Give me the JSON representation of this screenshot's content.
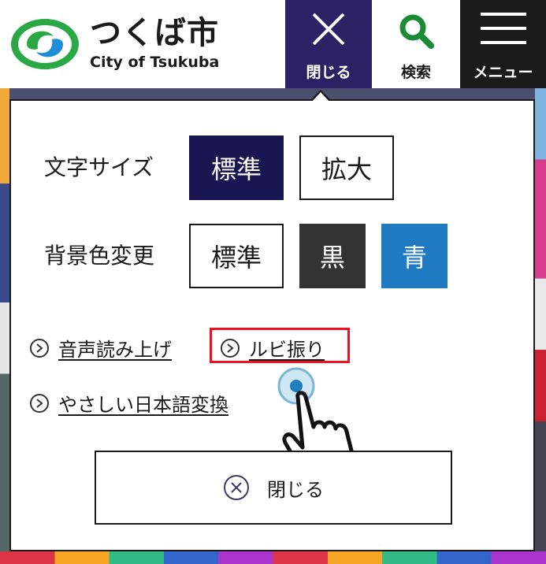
{
  "header": {
    "logo_ja": "つくば市",
    "logo_en": "City of Tsukuba",
    "close_label": "閉じる",
    "search_label": "検索",
    "menu_label": "メニュー"
  },
  "panel": {
    "text_size": {
      "label": "文字サイズ",
      "options": [
        "標準",
        "拡大"
      ],
      "selected": "標準"
    },
    "bg_color": {
      "label": "背景色変更",
      "options": [
        "標準",
        "黒",
        "青"
      ]
    },
    "links": {
      "voice": "音声読み上げ",
      "ruby": "ルビ振り",
      "easy_japanese": "やさしい日本語変換"
    },
    "close_button": "閉じる"
  },
  "colors": {
    "header_close_bg": "#2a2264",
    "active_option_bg": "#1a1652",
    "black_option_bg": "#333333",
    "blue_option_bg": "#1f7ac2",
    "highlight_border": "#ee1122",
    "logo_green": "#2aa845",
    "logo_blue": "#1e8ed8"
  },
  "icons": {
    "close": "close-icon",
    "search": "search-icon",
    "menu": "hamburger-icon",
    "link_arrow": "chevron-right-circle-icon",
    "close_circle": "close-circle-icon",
    "pointer": "pointing-hand-icon"
  }
}
